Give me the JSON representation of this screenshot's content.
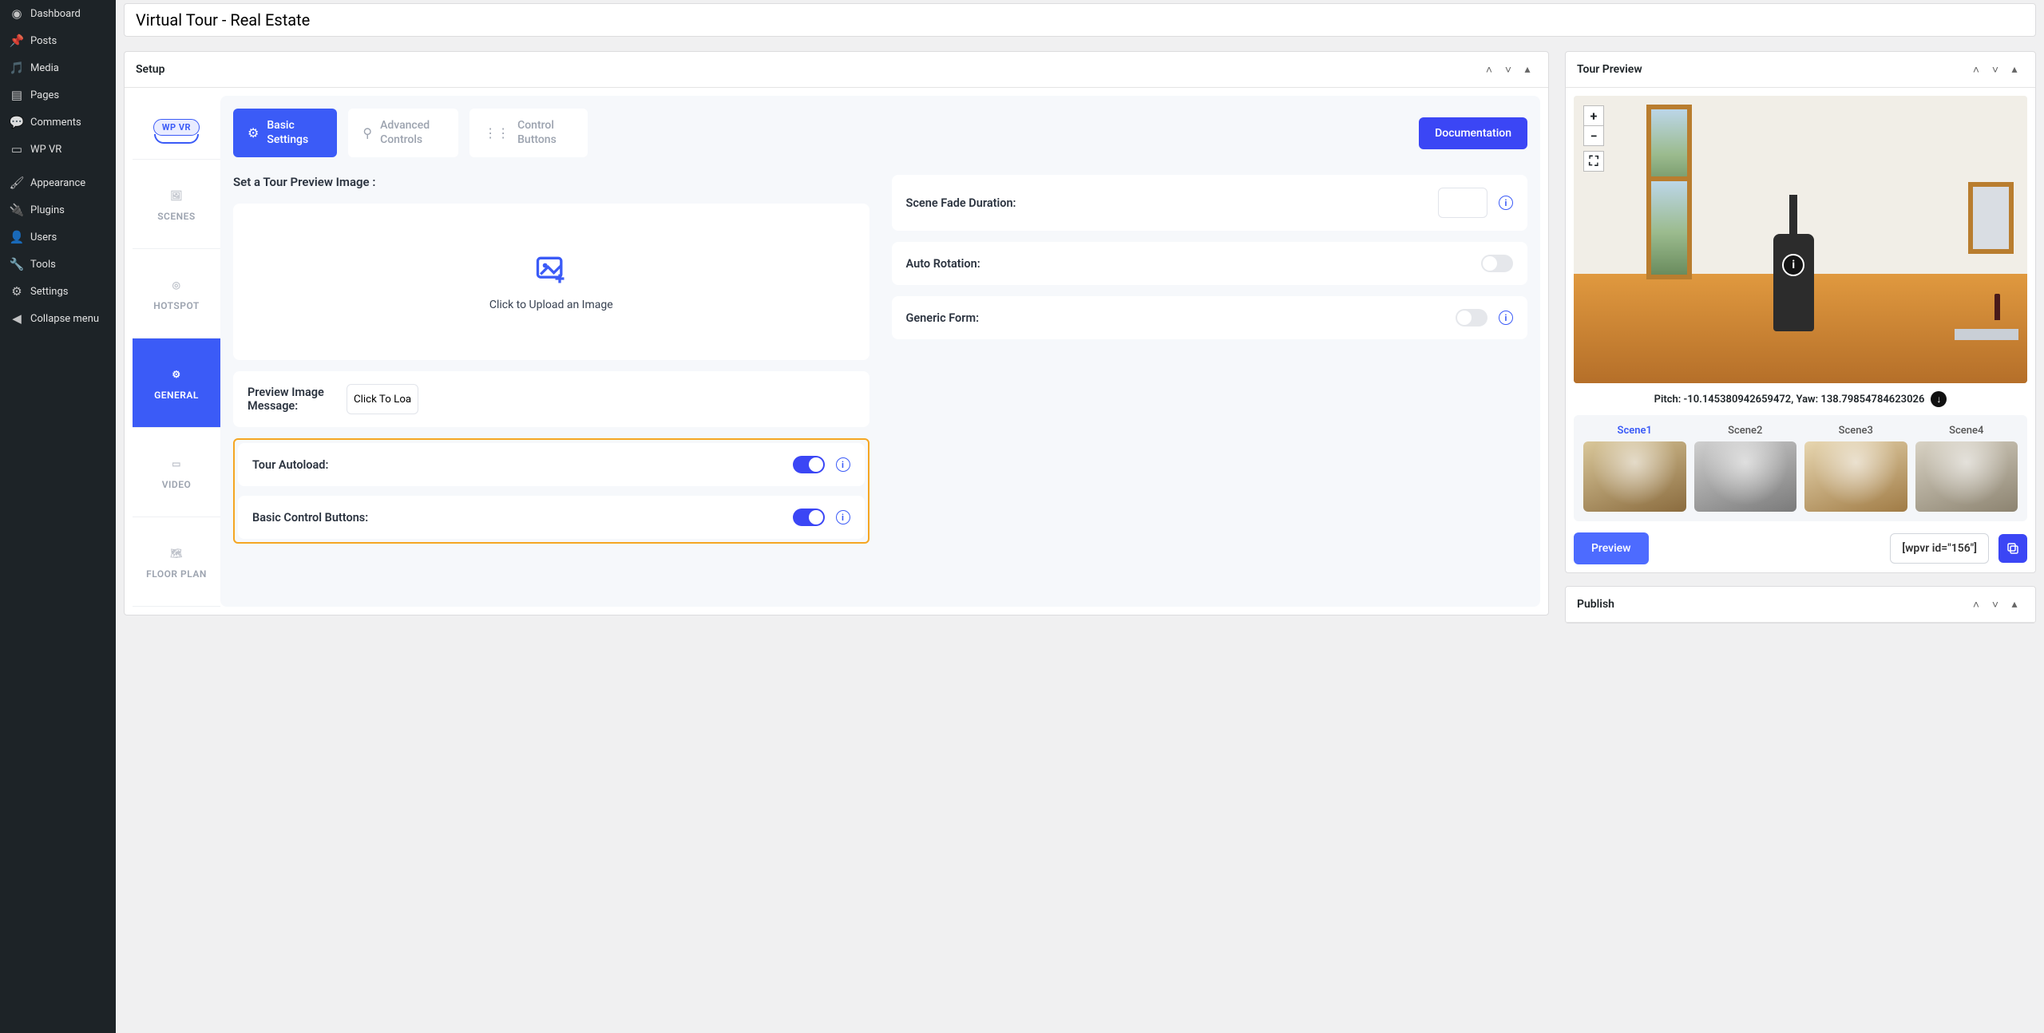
{
  "title": "Virtual Tour - Real Estate",
  "wpMenu": {
    "dashboard": "Dashboard",
    "posts": "Posts",
    "media": "Media",
    "pages": "Pages",
    "comments": "Comments",
    "wpvr": "WP VR",
    "appearance": "Appearance",
    "plugins": "Plugins",
    "users": "Users",
    "tools": "Tools",
    "settings": "Settings",
    "collapse": "Collapse menu"
  },
  "setup": {
    "heading": "Setup",
    "logo": "WP VR",
    "vtabs": {
      "scenes": "SCENES",
      "hotspot": "HOTSPOT",
      "general": "GENERAL",
      "video": "VIDEO",
      "floorplan": "FLOOR PLAN"
    },
    "htabs": {
      "basic": "Basic Settings",
      "advanced": "Advanced Controls",
      "buttons": "Control Buttons",
      "docs": "Documentation"
    },
    "previewImage": {
      "heading": "Set a Tour Preview Image :",
      "upload": "Click to Upload an Image",
      "msgLabel": "Preview Image Message:",
      "msgValue": "Click To Load"
    },
    "fields": {
      "autoload": "Tour Autoload:",
      "basicButtons": "Basic Control Buttons:",
      "fadeDuration": "Scene Fade Duration:",
      "autoRotation": "Auto Rotation:",
      "genericForm": "Generic Form:"
    }
  },
  "preview": {
    "heading": "Tour Preview",
    "pitchYaw": "Pitch: -10.145380942659472, Yaw: 138.79854784623026",
    "scenes": [
      "Scene1",
      "Scene2",
      "Scene3",
      "Scene4"
    ],
    "button": "Preview",
    "shortcode": "[wpvr id=\"156\"]"
  },
  "publish": {
    "heading": "Publish"
  }
}
